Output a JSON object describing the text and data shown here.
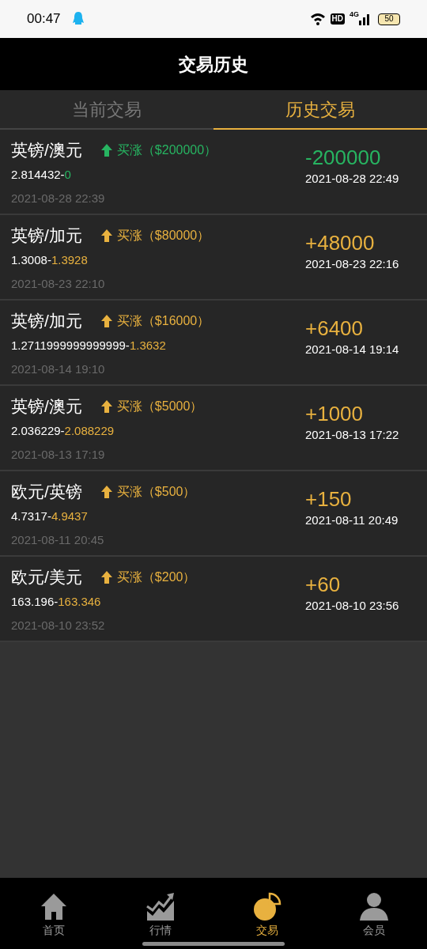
{
  "status_bar": {
    "time": "00:47",
    "hd": "HD",
    "network": "4G",
    "battery": "50"
  },
  "header": {
    "title": "交易历史"
  },
  "tabs": [
    {
      "label": "当前交易",
      "selected": false
    },
    {
      "label": "历史交易",
      "selected": true
    }
  ],
  "trades": [
    {
      "pair": "英镑/澳元",
      "direction": "买涨",
      "amount": "（$200000）",
      "open_price": "2.814432-",
      "close_price": "0",
      "open_time": "2021-08-28 22:39",
      "profit": "-200000",
      "close_time": "2021-08-28 22:49",
      "color": "#27b461"
    },
    {
      "pair": "英镑/加元",
      "direction": "买涨",
      "amount": "（$80000）",
      "open_price": "1.3008-",
      "close_price": "1.3928",
      "open_time": "2021-08-23 22:10",
      "profit": "+48000",
      "close_time": "2021-08-23 22:16",
      "color": "#e8b13f"
    },
    {
      "pair": "英镑/加元",
      "direction": "买涨",
      "amount": "（$16000）",
      "open_price": "1.2711999999999999-",
      "close_price": "1.3632",
      "open_time": "2021-08-14 19:10",
      "profit": "+6400",
      "close_time": "2021-08-14 19:14",
      "color": "#e8b13f"
    },
    {
      "pair": "英镑/澳元",
      "direction": "买涨",
      "amount": "（$5000）",
      "open_price": "2.036229-",
      "close_price": "2.088229",
      "open_time": "2021-08-13 17:19",
      "profit": "+1000",
      "close_time": "2021-08-13 17:22",
      "color": "#e8b13f"
    },
    {
      "pair": "欧元/英镑",
      "direction": "买涨",
      "amount": "（$500）",
      "open_price": "4.7317-",
      "close_price": "4.9437",
      "open_time": "2021-08-11 20:45",
      "profit": "+150",
      "close_time": "2021-08-11 20:49",
      "color": "#e8b13f"
    },
    {
      "pair": "欧元/美元",
      "direction": "买涨",
      "amount": "（$200）",
      "open_price": "163.196-",
      "close_price": "163.346",
      "open_time": "2021-08-10 23:52",
      "profit": "+60",
      "close_time": "2021-08-10 23:56",
      "color": "#e8b13f"
    }
  ],
  "nav": [
    {
      "kind": "home",
      "label": "首页",
      "selected": false
    },
    {
      "kind": "market",
      "label": "行情",
      "selected": false
    },
    {
      "kind": "trade",
      "label": "交易",
      "selected": true
    },
    {
      "kind": "member",
      "label": "会员",
      "selected": false
    }
  ]
}
